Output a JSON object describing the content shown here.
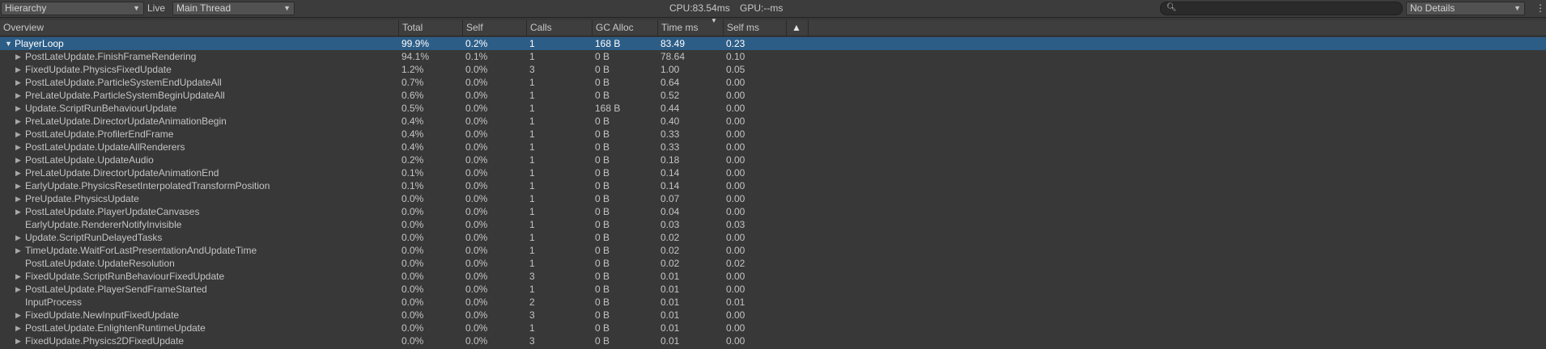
{
  "toolbar": {
    "view_mode": "Hierarchy",
    "live_label": "Live",
    "thread": "Main Thread",
    "cpu": "CPU:83.54ms",
    "gpu": "GPU:--ms",
    "search_value": "",
    "details": "No Details"
  },
  "columns": {
    "overview": "Overview",
    "total": "Total",
    "self": "Self",
    "calls": "Calls",
    "gc_alloc": "GC Alloc",
    "time_ms": "Time ms",
    "self_ms": "Self ms",
    "sorted_by": "Time ms",
    "warning_icon": "warning-triangle-icon"
  },
  "rows": [
    {
      "name": "PlayerLoop",
      "total": "99.9%",
      "self": "0.2%",
      "calls": "1",
      "gc": "168 B",
      "time": "83.49",
      "selfms": "0.23",
      "expandable": true,
      "expanded": true,
      "selected": true
    },
    {
      "name": "PostLateUpdate.FinishFrameRendering",
      "total": "94.1%",
      "self": "0.1%",
      "calls": "1",
      "gc": "0 B",
      "time": "78.64",
      "selfms": "0.10",
      "expandable": true
    },
    {
      "name": "FixedUpdate.PhysicsFixedUpdate",
      "total": "1.2%",
      "self": "0.0%",
      "calls": "3",
      "gc": "0 B",
      "time": "1.00",
      "selfms": "0.05",
      "expandable": true
    },
    {
      "name": "PostLateUpdate.ParticleSystemEndUpdateAll",
      "total": "0.7%",
      "self": "0.0%",
      "calls": "1",
      "gc": "0 B",
      "time": "0.64",
      "selfms": "0.00",
      "expandable": true
    },
    {
      "name": "PreLateUpdate.ParticleSystemBeginUpdateAll",
      "total": "0.6%",
      "self": "0.0%",
      "calls": "1",
      "gc": "0 B",
      "time": "0.52",
      "selfms": "0.00",
      "expandable": true
    },
    {
      "name": "Update.ScriptRunBehaviourUpdate",
      "total": "0.5%",
      "self": "0.0%",
      "calls": "1",
      "gc": "168 B",
      "time": "0.44",
      "selfms": "0.00",
      "expandable": true
    },
    {
      "name": "PreLateUpdate.DirectorUpdateAnimationBegin",
      "total": "0.4%",
      "self": "0.0%",
      "calls": "1",
      "gc": "0 B",
      "time": "0.40",
      "selfms": "0.00",
      "expandable": true
    },
    {
      "name": "PostLateUpdate.ProfilerEndFrame",
      "total": "0.4%",
      "self": "0.0%",
      "calls": "1",
      "gc": "0 B",
      "time": "0.33",
      "selfms": "0.00",
      "expandable": true
    },
    {
      "name": "PostLateUpdate.UpdateAllRenderers",
      "total": "0.4%",
      "self": "0.0%",
      "calls": "1",
      "gc": "0 B",
      "time": "0.33",
      "selfms": "0.00",
      "expandable": true
    },
    {
      "name": "PostLateUpdate.UpdateAudio",
      "total": "0.2%",
      "self": "0.0%",
      "calls": "1",
      "gc": "0 B",
      "time": "0.18",
      "selfms": "0.00",
      "expandable": true
    },
    {
      "name": "PreLateUpdate.DirectorUpdateAnimationEnd",
      "total": "0.1%",
      "self": "0.0%",
      "calls": "1",
      "gc": "0 B",
      "time": "0.14",
      "selfms": "0.00",
      "expandable": true
    },
    {
      "name": "EarlyUpdate.PhysicsResetInterpolatedTransformPosition",
      "total": "0.1%",
      "self": "0.0%",
      "calls": "1",
      "gc": "0 B",
      "time": "0.14",
      "selfms": "0.00",
      "expandable": true
    },
    {
      "name": "PreUpdate.PhysicsUpdate",
      "total": "0.0%",
      "self": "0.0%",
      "calls": "1",
      "gc": "0 B",
      "time": "0.07",
      "selfms": "0.00",
      "expandable": true
    },
    {
      "name": "PostLateUpdate.PlayerUpdateCanvases",
      "total": "0.0%",
      "self": "0.0%",
      "calls": "1",
      "gc": "0 B",
      "time": "0.04",
      "selfms": "0.00",
      "expandable": true
    },
    {
      "name": "EarlyUpdate.RendererNotifyInvisible",
      "total": "0.0%",
      "self": "0.0%",
      "calls": "1",
      "gc": "0 B",
      "time": "0.03",
      "selfms": "0.03",
      "expandable": false
    },
    {
      "name": "Update.ScriptRunDelayedTasks",
      "total": "0.0%",
      "self": "0.0%",
      "calls": "1",
      "gc": "0 B",
      "time": "0.02",
      "selfms": "0.00",
      "expandable": true
    },
    {
      "name": "TimeUpdate.WaitForLastPresentationAndUpdateTime",
      "total": "0.0%",
      "self": "0.0%",
      "calls": "1",
      "gc": "0 B",
      "time": "0.02",
      "selfms": "0.00",
      "expandable": true
    },
    {
      "name": "PostLateUpdate.UpdateResolution",
      "total": "0.0%",
      "self": "0.0%",
      "calls": "1",
      "gc": "0 B",
      "time": "0.02",
      "selfms": "0.02",
      "expandable": false
    },
    {
      "name": "FixedUpdate.ScriptRunBehaviourFixedUpdate",
      "total": "0.0%",
      "self": "0.0%",
      "calls": "3",
      "gc": "0 B",
      "time": "0.01",
      "selfms": "0.00",
      "expandable": true
    },
    {
      "name": "PostLateUpdate.PlayerSendFrameStarted",
      "total": "0.0%",
      "self": "0.0%",
      "calls": "1",
      "gc": "0 B",
      "time": "0.01",
      "selfms": "0.00",
      "expandable": true
    },
    {
      "name": "InputProcess",
      "total": "0.0%",
      "self": "0.0%",
      "calls": "2",
      "gc": "0 B",
      "time": "0.01",
      "selfms": "0.01",
      "expandable": false
    },
    {
      "name": "FixedUpdate.NewInputFixedUpdate",
      "total": "0.0%",
      "self": "0.0%",
      "calls": "3",
      "gc": "0 B",
      "time": "0.01",
      "selfms": "0.00",
      "expandable": true
    },
    {
      "name": "PostLateUpdate.EnlightenRuntimeUpdate",
      "total": "0.0%",
      "self": "0.0%",
      "calls": "1",
      "gc": "0 B",
      "time": "0.01",
      "selfms": "0.00",
      "expandable": true
    },
    {
      "name": "FixedUpdate.Physics2DFixedUpdate",
      "total": "0.0%",
      "self": "0.0%",
      "calls": "3",
      "gc": "0 B",
      "time": "0.01",
      "selfms": "0.00",
      "expandable": true
    }
  ]
}
